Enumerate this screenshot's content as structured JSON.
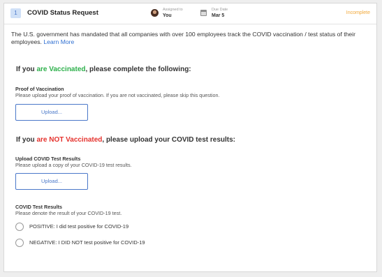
{
  "header": {
    "step_number": "1",
    "title": "COVID Status Request",
    "assigned_label": "Assigned to",
    "assigned_value": "You",
    "due_label": "Due Date",
    "due_value": "Mar 5",
    "status": "Incomplete"
  },
  "intro": {
    "text": "The U.S. government has mandated that all companies with over 100 employees track the COVID vaccination / test status of their employees.",
    "link": "Learn More"
  },
  "vaccinated": {
    "heading_prefix": "If you ",
    "heading_highlight": "are Vaccinated",
    "heading_suffix": ", please complete the following:",
    "proof_label": "Proof of Vaccination",
    "proof_help": "Please upload your proof of vaccination. If you are not vaccinated, please skip this question.",
    "upload_label": "Upload..."
  },
  "not_vaccinated": {
    "heading_prefix": "If you ",
    "heading_highlight": "are NOT Vaccinated",
    "heading_suffix": ", please upload your COVID test results:",
    "upload_results_label": "Upload COVID Test Results",
    "upload_results_help": "Please upload a copy of your COVID-19 test results.",
    "upload_label": "Upload...",
    "results_label": "COVID Test Results",
    "results_help": "Please denote the result of your COVID-19 test.",
    "options": [
      "POSITIVE: I did test positive for COVID-19",
      "NEGATIVE: I DID NOT test positive for COVID-19"
    ]
  },
  "colors": {
    "accent": "#4a78c9",
    "positive_highlight": "#2db04b",
    "negative_highlight": "#e5322d",
    "status": "#f2a93b"
  },
  "icons": {
    "avatar": "user-avatar",
    "due_date": "calendar-icon"
  }
}
